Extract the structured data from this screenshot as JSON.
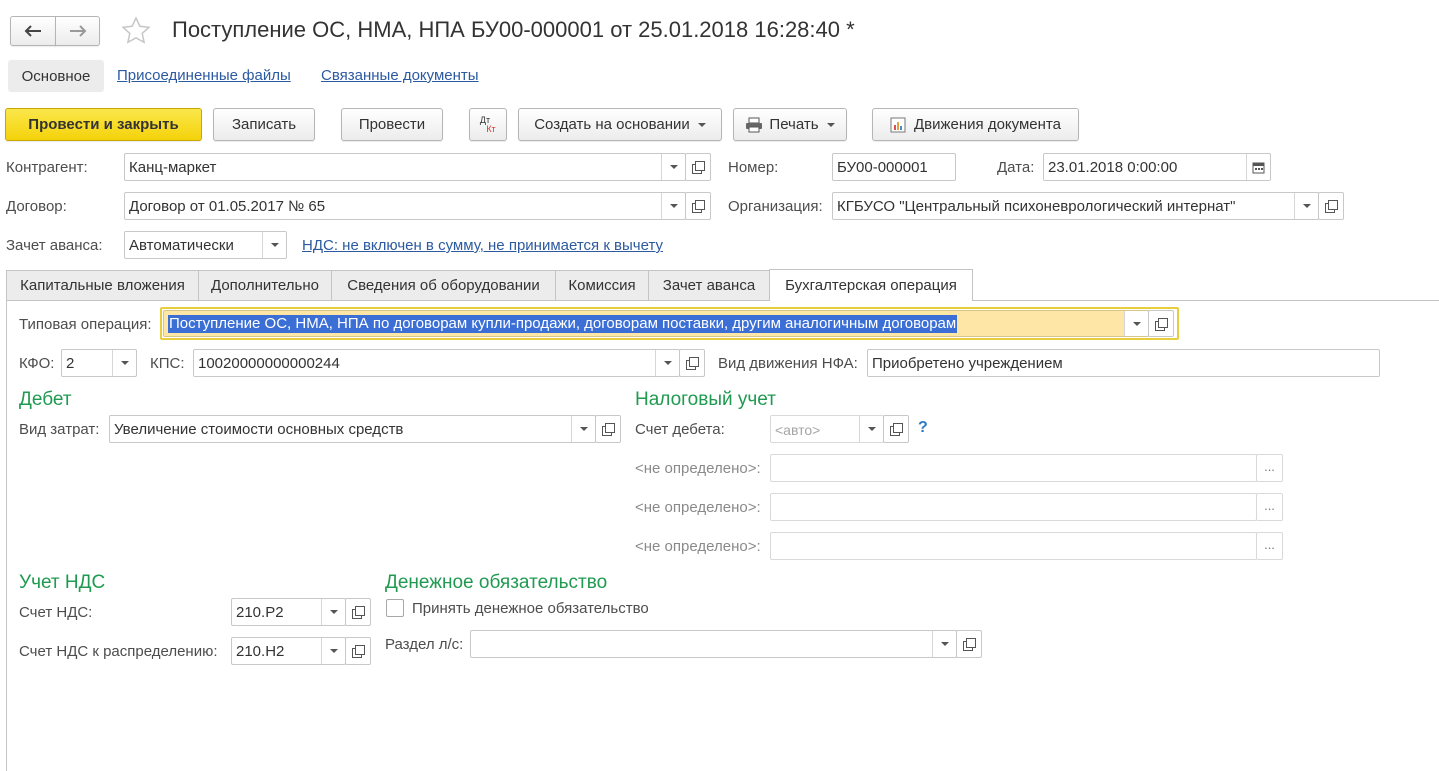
{
  "header": {
    "title": "Поступление ОС, НМА, НПА БУ00-000001 от 25.01.2018 16:28:40 *"
  },
  "nav_tabs": {
    "main": "Основное",
    "files": "Присоединенные файлы",
    "related": "Связанные документы"
  },
  "toolbar": {
    "post_close": "Провести и закрыть",
    "save": "Записать",
    "post": "Провести",
    "dtkt_top": "Дт",
    "dtkt_bottom": "Кт",
    "create_based": "Создать на основании",
    "print": "Печать",
    "movements": "Движения документа"
  },
  "form": {
    "counterparty_label": "Контрагент:",
    "counterparty": "Канц-маркет",
    "number_label": "Номер:",
    "number": "БУ00-000001",
    "date_label": "Дата:",
    "date": "23.01.2018  0:00:00",
    "contract_label": "Договор:",
    "contract": "Договор от 01.05.2017 № 65",
    "org_label": "Организация:",
    "org": "КГБУСО \"Центральный психоневрологический интернат\"",
    "advance_label": "Зачет аванса:",
    "advance": "Автоматически",
    "vat_link": "НДС: не включен в сумму, не принимается к вычету"
  },
  "tabs": [
    "Капитальные вложения",
    "Дополнительно",
    "Сведения об оборудовании",
    "Комиссия",
    "Зачет аванса",
    "Бухгалтерская операция"
  ],
  "operation": {
    "typical_label": "Типовая операция:",
    "typical": "Поступление ОС, НМА, НПА по договорам купли-продажи, договорам поставки, другим аналогичным договорам",
    "kfo_label": "КФО:",
    "kfo": "2",
    "kps_label": "КПС:",
    "kps": "10020000000000244",
    "nfa_label": "Вид движения НФА:",
    "nfa": "Приобретено учреждением"
  },
  "debit": {
    "title": "Дебет",
    "cost_label": "Вид затрат:",
    "cost": "Увеличение стоимости основных средств"
  },
  "tax": {
    "title": "Налоговый учет",
    "account_label": "Счет дебета:",
    "account_placeholder": "<авто>",
    "help": "?",
    "undefined1": "<не определено>:",
    "undefined2": "<не определено>:",
    "undefined3": "<не определено>:",
    "dots": "..."
  },
  "vat": {
    "title": "Учет НДС",
    "account_label": "Счет НДС:",
    "account": "210.Р2",
    "dist_label": "Счет НДС к распределению:",
    "dist": "210.Н2"
  },
  "money": {
    "title": "Денежное обязательство",
    "accept_label": "Принять денежное обязательство",
    "section_label": "Раздел л/с:",
    "section": ""
  },
  "colors": {
    "section_green": "#1f9a50",
    "link_blue": "#2c5aa0",
    "primary_yellow": "#f4d20a",
    "selection_blue": "#3b6fd6"
  }
}
